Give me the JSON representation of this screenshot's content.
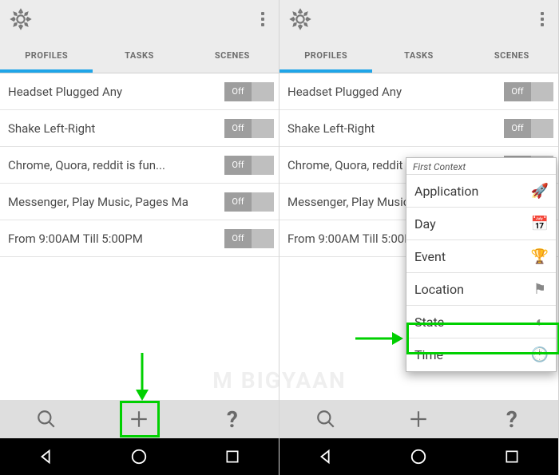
{
  "tabs": [
    "PROFILES",
    "TASKS",
    "SCENES"
  ],
  "toggle_label": "Off",
  "profiles": [
    "Headset Plugged Any",
    "Shake Left-Right",
    "Chrome, Quora, reddit is fun...",
    "Messenger, Play Music, Pages Ma",
    "From  9:00AM Till  5:00PM"
  ],
  "context_menu": {
    "title": "First Context",
    "items": [
      {
        "label": "Application",
        "icon": "🚀"
      },
      {
        "label": "Day",
        "icon": "📅"
      },
      {
        "label": "Event",
        "icon": "🏆"
      },
      {
        "label": "Location",
        "icon": "⚑"
      },
      {
        "label": "State",
        "icon": "◐"
      },
      {
        "label": "Time",
        "icon": "🕐"
      }
    ]
  },
  "watermark": "M   BIGYAAN"
}
